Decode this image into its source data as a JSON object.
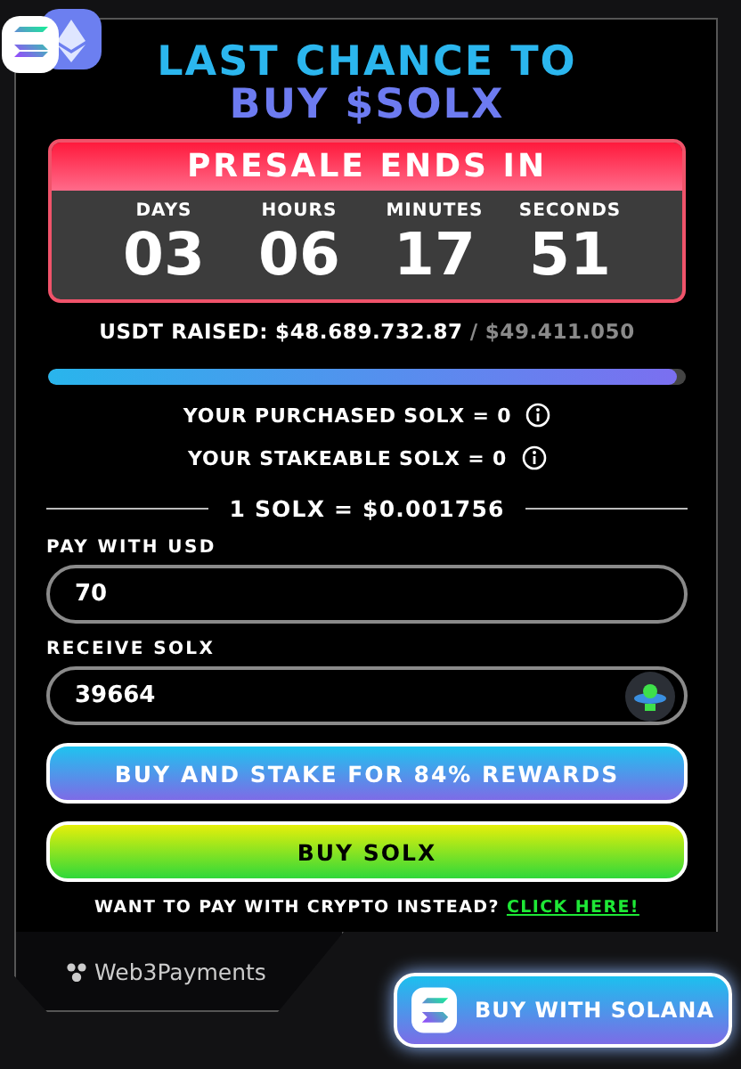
{
  "header": {
    "title_line_1": "LAST CHANCE TO",
    "title_line_2": "BUY $SOLX"
  },
  "countdown": {
    "title": "PRESALE ENDS IN",
    "units": [
      {
        "label": "DAYS",
        "value": "03"
      },
      {
        "label": "HOURS",
        "value": "06"
      },
      {
        "label": "MINUTES",
        "value": "17"
      },
      {
        "label": "SECONDS",
        "value": "51"
      }
    ]
  },
  "raised": {
    "label": "USDT RAISED:",
    "amount": "$48.689.732.87",
    "separator": "/",
    "goal": "$49.411.050"
  },
  "progress": {
    "level": 0.985
  },
  "balances": [
    {
      "label": "YOUR PURCHASED SOLX = 0"
    },
    {
      "label": "YOUR STAKEABLE SOLX = 0"
    }
  ],
  "price": "1 SOLX = $0.001756",
  "fields": [
    {
      "label": "PAY WITH USD",
      "value": "70",
      "kind": "plain"
    },
    {
      "label": "RECEIVE SOLX",
      "value": "39664",
      "kind": "token"
    }
  ],
  "buttons": [
    {
      "label": "BUY AND STAKE FOR 84% REWARDS",
      "kind": "stake"
    },
    {
      "label": "BUY SOLX",
      "kind": "buy"
    }
  ],
  "crypto_prompt": {
    "text": "WANT TO PAY WITH CRYPTO INSTEAD?",
    "link": "CLICK HERE!"
  },
  "footer": {
    "brand": "Web3Payments",
    "button": "BUY WITH SOLANA"
  }
}
